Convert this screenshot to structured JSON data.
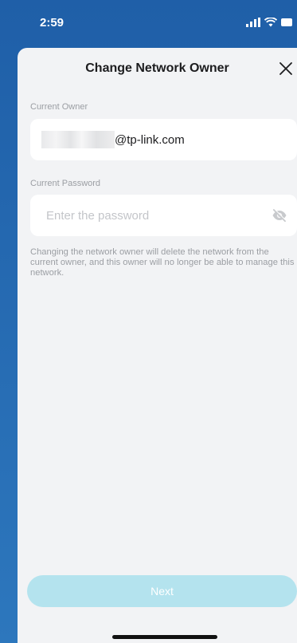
{
  "status_bar": {
    "time": "2:59",
    "icons": [
      "signal-icon",
      "wifi-icon",
      "battery-icon"
    ]
  },
  "sheet": {
    "title": "Change Network Owner",
    "close_icon": "close-icon"
  },
  "current_owner": {
    "label": "Current Owner",
    "email_domain": "@tp-link.com"
  },
  "current_password": {
    "label": "Current Password",
    "placeholder": "Enter the password",
    "visibility_icon": "eye-off-icon"
  },
  "info": {
    "text": "Changing the network owner will delete the network from the current owner, and this owner will no longer be able to manage this network."
  },
  "actions": {
    "next_label": "Next"
  },
  "colors": {
    "header_blue": "#1f5fa8",
    "sheet_bg": "#f2f3f5",
    "button_disabled": "#b4e3ee",
    "muted_text": "#9b9ea3"
  }
}
